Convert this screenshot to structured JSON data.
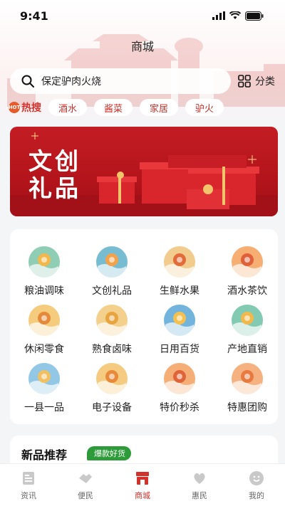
{
  "status_bar": {
    "time": "9:41"
  },
  "header": {
    "title": "商城"
  },
  "search": {
    "text": "保定驴肉火烧",
    "category_label": "分类"
  },
  "hot_search": {
    "label": "热搜",
    "badge": "HOT",
    "chips": [
      "酒水",
      "酱菜",
      "家居",
      "驴火"
    ]
  },
  "banner": {
    "title": "文创礼品"
  },
  "categories": [
    {
      "label": "粮油调味",
      "icon": "grain-oil-icon"
    },
    {
      "label": "文创礼品",
      "icon": "gift-culture-icon"
    },
    {
      "label": "生鲜水果",
      "icon": "fresh-fruit-icon"
    },
    {
      "label": "酒水茶饮",
      "icon": "drinks-icon"
    },
    {
      "label": "休闲零食",
      "icon": "snack-icon"
    },
    {
      "label": "熟食卤味",
      "icon": "cooked-food-icon"
    },
    {
      "label": "日用百货",
      "icon": "daily-goods-icon"
    },
    {
      "label": "产地直销",
      "icon": "origin-direct-icon"
    },
    {
      "label": "一县一品",
      "icon": "county-product-icon"
    },
    {
      "label": "电子设备",
      "icon": "electronics-icon"
    },
    {
      "label": "特价秒杀",
      "icon": "flash-sale-icon"
    },
    {
      "label": "特惠团购",
      "icon": "group-buy-icon"
    }
  ],
  "new_products": {
    "title": "新品推荐",
    "badge": "爆款好货"
  },
  "tabbar": [
    {
      "label": "资讯",
      "icon": "news-icon",
      "active": false
    },
    {
      "label": "便民",
      "icon": "handshake-icon",
      "active": false
    },
    {
      "label": "商城",
      "icon": "shop-icon",
      "active": true
    },
    {
      "label": "惠民",
      "icon": "heart-hands-icon",
      "active": false
    },
    {
      "label": "我的",
      "icon": "profile-icon",
      "active": false
    }
  ],
  "colors": {
    "accent": "#d2312c",
    "banner": "#c41d24",
    "badge_green": "#2e9b3a"
  }
}
